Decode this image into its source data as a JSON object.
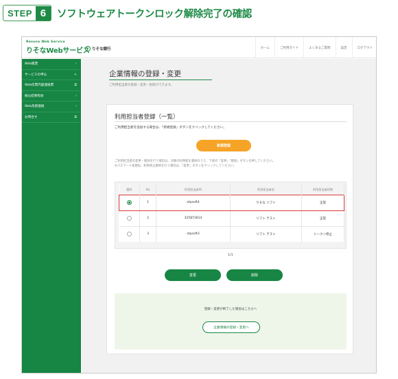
{
  "step": {
    "label": "STEP",
    "number": "6",
    "title": "ソフトウェアトークンロック解除完了の確認"
  },
  "app": {
    "brand_small": "Resona Web Service",
    "brand_main": "りそなWebサービス",
    "bank_name": "りそな銀行",
    "topnav": [
      "ホーム",
      "ご利用ガイド",
      "よくあるご質問",
      "設定",
      "ログアウト"
    ]
  },
  "sidebar": {
    "items": [
      {
        "label": "Web帳票",
        "icon": "chevron-right-icon"
      },
      {
        "label": "サービスの申込",
        "icon": "plus-icon"
      },
      {
        "label": "Web伝票内容連絡票",
        "icon": "external-link-icon"
      },
      {
        "label": "振込結果照会",
        "icon": "chevron-right-icon"
      },
      {
        "label": "Web為替連絡",
        "icon": "chevron-right-icon"
      },
      {
        "label": "お問合せ",
        "icon": "external-link-icon"
      }
    ]
  },
  "main": {
    "page_title": "企業情報の登録・変更",
    "page_desc": "ご利用担当者の登録・変更・削除ができます。",
    "card_title": "利用担当者登録（一覧）",
    "card_instruction": "ご利用担当者を追加する場合は、「新規登録」ボタンをクリックしてください。",
    "new_button": "新規登録",
    "note_line1": "ご利用担当者の変更・削除を行う場合は、対象の利用者を選択のうえ、下部の「変更」「削除」ボタンを押してください。",
    "note_line2": "※パスワード初期化、利用停止解除を行う場合は、「変更」ボタンをクリックしてください。",
    "table": {
      "headers": [
        "選択",
        "No",
        "利用担当者ID",
        "利用担当者名",
        "利用担当者状態"
      ],
      "rows": [
        {
          "selected": true,
          "no": "1",
          "id": "otpsoft4",
          "name": "りそな ソフト",
          "status": "正常"
        },
        {
          "selected": false,
          "no": "2",
          "id": "325873614",
          "name": "ソフト テスト",
          "status": "正常"
        },
        {
          "selected": false,
          "no": "3",
          "id": "otpsoft3",
          "name": "ソフト テスト",
          "status": "トークン停止"
        }
      ]
    },
    "pager": "1/1",
    "change_button": "変更",
    "delete_button": "削除",
    "done_text": "登録・変更が終了した場合はこちらへ",
    "back_button": "企業情報の登録・変更へ"
  }
}
